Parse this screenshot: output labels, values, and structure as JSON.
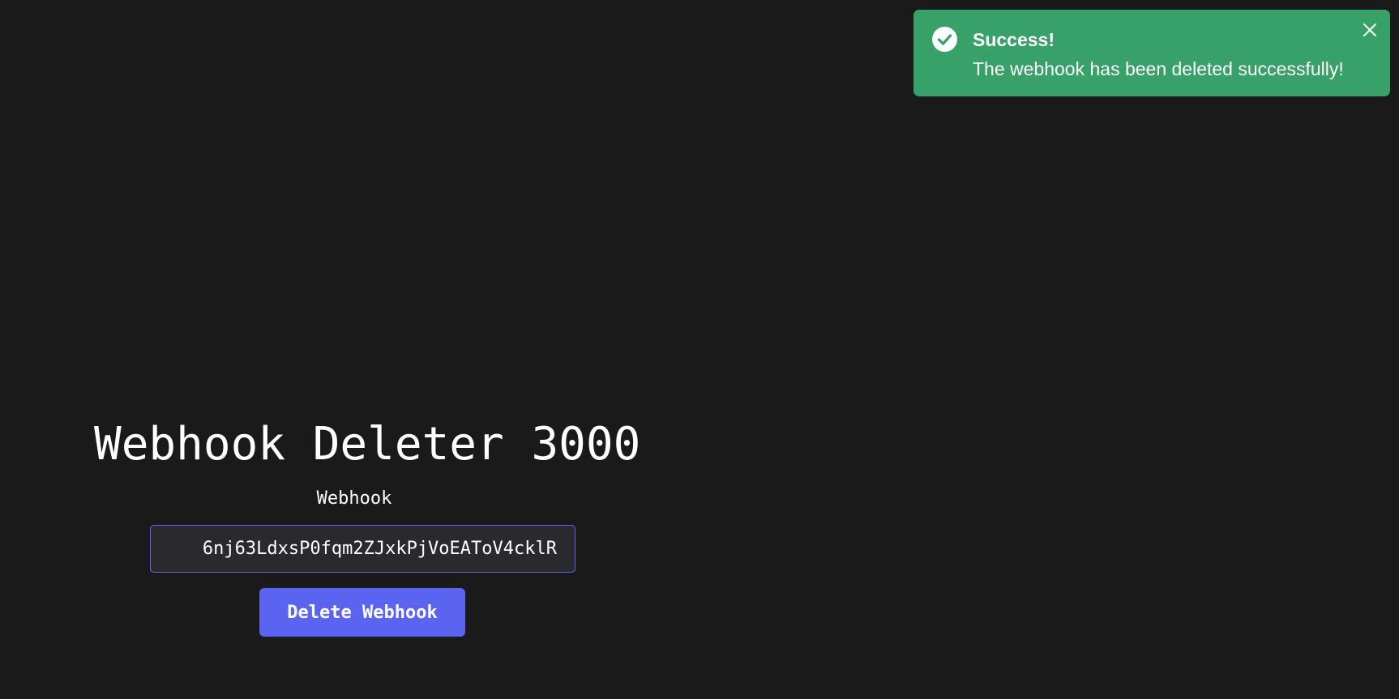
{
  "toast": {
    "title": "Success!",
    "message": "The webhook has been deleted successfully!",
    "icon": "check-circle-icon",
    "close_icon": "close-icon",
    "color": "#38a169"
  },
  "app": {
    "title": "Webhook Deleter 3000",
    "webhook_label": "Webhook",
    "webhook_value": "6nj63LdxsP0fqm2ZJxkPjVoEAToV4cklR",
    "delete_button_label": "Delete Webhook",
    "accent_color": "#5b63f1",
    "background_color": "#1a1a1a"
  }
}
